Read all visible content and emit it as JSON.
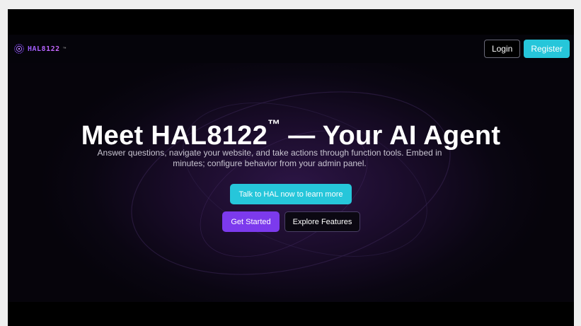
{
  "nav": {
    "logo_text": "HAL8122",
    "logo_tm": "™",
    "login_label": "Login",
    "register_label": "Register"
  },
  "hero": {
    "title": "Meet HAL8122",
    "title_tm": "™",
    "title_rest": " — Your AI Agent",
    "subtitle": "Answer questions, navigate your website, and take actions through function tools. Embed in minutes; configure behavior from your admin panel.",
    "talk_label": "Talk to HAL now to learn more",
    "get_started_label": "Get Started",
    "explore_label": "Explore Features"
  },
  "colors": {
    "accent_cyan": "#26c6da",
    "accent_purple": "#7c3aed",
    "background": "#000000"
  },
  "icons": {
    "logo": "gear-ring-icon"
  }
}
